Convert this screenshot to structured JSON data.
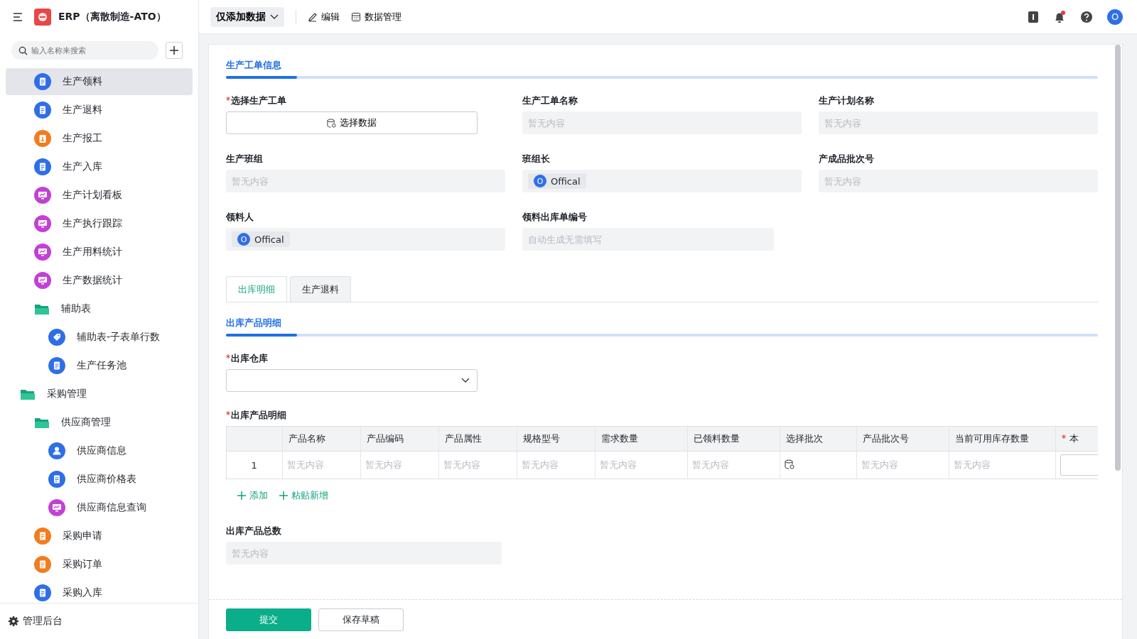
{
  "app": {
    "title": "ERP（离散制造-ATO）"
  },
  "sidebar": {
    "search": {
      "placeholder": "输入名称来搜索"
    },
    "groups": [
      {
        "children": [
          {
            "label": "生产领料",
            "kind": "form",
            "color": "#2f6fe6",
            "selected": true
          },
          {
            "label": "生产退料",
            "kind": "form",
            "color": "#2f6fe6",
            "selected": false
          },
          {
            "label": "生产报工",
            "kind": "report",
            "color": "#f27c1e",
            "selected": false
          },
          {
            "label": "生产入库",
            "kind": "form",
            "color": "#2f6fe6",
            "selected": false
          },
          {
            "label": "生产计划看板",
            "kind": "dashboard",
            "color": "#c340d6",
            "selected": false
          },
          {
            "label": "生产执行跟踪",
            "kind": "dashboard",
            "color": "#c340d6",
            "selected": false
          },
          {
            "label": "生产用料统计",
            "kind": "dashboard",
            "color": "#c340d6",
            "selected": false
          },
          {
            "label": "生产数据统计",
            "kind": "dashboard",
            "color": "#c340d6",
            "selected": false
          },
          {
            "label": "辅助表",
            "kind": "folder",
            "selected": false,
            "children": [
              {
                "label": "辅助表-子表单行数",
                "kind": "tag",
                "color": "#2f6fe6",
                "selected": false
              },
              {
                "label": "生产任务池",
                "kind": "form",
                "color": "#2f6fe6",
                "selected": false
              }
            ]
          }
        ]
      },
      {
        "label": "采购管理",
        "kind": "folder",
        "selected": false,
        "children": [
          {
            "label": "供应商管理",
            "kind": "folder",
            "selected": false,
            "children": [
              {
                "label": "供应商信息",
                "kind": "contact",
                "color": "#2f6fe6",
                "selected": false
              },
              {
                "label": "供应商价格表",
                "kind": "form",
                "color": "#2f6fe6",
                "selected": false
              },
              {
                "label": "供应商信息查询",
                "kind": "dashboard",
                "color": "#c340d6",
                "selected": false
              }
            ]
          },
          {
            "label": "采购申请",
            "kind": "form",
            "color": "#f27c1e",
            "selected": false
          },
          {
            "label": "采购订单",
            "kind": "form",
            "color": "#f27c1e",
            "selected": false
          },
          {
            "label": "采购入库",
            "kind": "form",
            "color": "#2f6fe6",
            "selected": false
          }
        ]
      }
    ],
    "footer": "管理后台"
  },
  "toolbar": {
    "mode": "仅添加数据",
    "actions": [
      {
        "label": "编辑",
        "kind": "edit"
      },
      {
        "label": "数据管理",
        "kind": "table"
      }
    ],
    "notification_dot": true,
    "avatar": "O"
  },
  "section": {
    "title": "生产工单信息",
    "level": 0.08
  },
  "fields": [
    {
      "label": "选择生产工单",
      "required": true,
      "kind": "picker",
      "value": "选择数据"
    },
    {
      "label": "生产工单名称",
      "required": false,
      "kind": "text",
      "placeholder": "暂无内容"
    },
    {
      "label": "生产计划名称",
      "required": false,
      "kind": "text",
      "placeholder": "暂无内容"
    },
    {
      "label": "生产班组",
      "required": false,
      "kind": "text",
      "placeholder": "暂无内容"
    },
    {
      "label": "班组长",
      "required": false,
      "kind": "user",
      "avatar": "O",
      "value": "Offical"
    },
    {
      "label": "产成品批次号",
      "required": false,
      "kind": "text",
      "placeholder": "暂无内容"
    },
    {
      "label": "领料人",
      "required": false,
      "kind": "user",
      "avatar": "O",
      "value": "Offical"
    },
    {
      "label": "领料出库单编号",
      "required": false,
      "kind": "auto",
      "placeholder": "自动生成无需填写"
    }
  ],
  "tabs": [
    {
      "label": "出库明细",
      "selected": true
    },
    {
      "label": "生产退料",
      "selected": false
    }
  ],
  "detail": {
    "title": "出库产品明细",
    "level": 0.08,
    "warehouse": {
      "label": "出库仓库",
      "required": true
    },
    "table": {
      "label": "出库产品明细",
      "required": true,
      "columns": [
        {
          "label": "产品名称",
          "required": false
        },
        {
          "label": "产品编码",
          "required": false
        },
        {
          "label": "产品属性",
          "required": false
        },
        {
          "label": "规格型号",
          "required": false
        },
        {
          "label": "需求数量",
          "required": false
        },
        {
          "label": "已领料数量",
          "required": false
        },
        {
          "label": "选择批次",
          "required": false
        },
        {
          "label": "产品批次号",
          "required": false
        },
        {
          "label": "当前可用库存数量",
          "required": false
        },
        {
          "label": "本",
          "required": true
        }
      ],
      "rows": [
        {
          "index": "1",
          "cells": [
            {
              "kind": "text",
              "text": "暂无内容"
            },
            {
              "kind": "text",
              "text": "暂无内容"
            },
            {
              "kind": "text",
              "text": "暂无内容"
            },
            {
              "kind": "text",
              "text": "暂无内容"
            },
            {
              "kind": "text",
              "text": "暂无内容"
            },
            {
              "kind": "text",
              "text": "暂无内容"
            },
            {
              "kind": "picker"
            },
            {
              "kind": "text",
              "text": "暂无内容"
            },
            {
              "kind": "text",
              "text": "暂无内容"
            },
            {
              "kind": "input"
            }
          ]
        }
      ],
      "actions": [
        "添加",
        "粘贴新增"
      ]
    },
    "total": {
      "label": "出库产品总数",
      "placeholder": "暂无内容"
    }
  },
  "buttons": [
    {
      "label": "提交",
      "kind": "primary"
    },
    {
      "label": "保存草稿",
      "kind": "secondary"
    }
  ]
}
